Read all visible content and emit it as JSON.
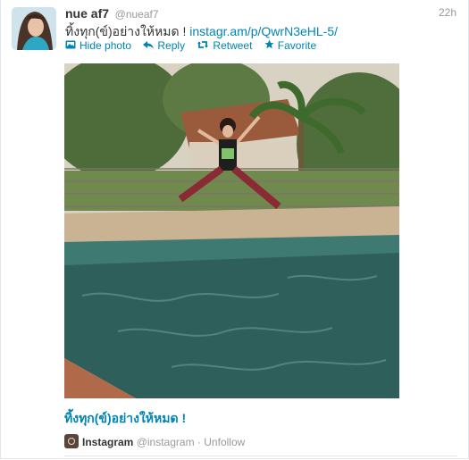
{
  "tweet": {
    "fullname": "nue af7",
    "screen_name": "@nueaf7",
    "time": "22h",
    "text": "ทิ้งทุก(ข์)อย่างให้หมด ! ",
    "link": "instagr.am/p/QwrN3eHL-5/"
  },
  "actions": {
    "hide_photo": "Hide photo",
    "reply": "Reply",
    "retweet": "Retweet",
    "favorite": "Favorite"
  },
  "card": {
    "caption": "ทิ้งทุก(ข์)อย่างให้หมด !",
    "source_name": "Instagram",
    "source_handle": "@instagram",
    "separator": "·",
    "unfollow": "Unfollow"
  },
  "icons": {
    "hide_photo": "photo-icon",
    "reply": "reply-icon",
    "retweet": "retweet-icon",
    "favorite": "star-icon",
    "source": "instagram-icon"
  },
  "colors": {
    "link": "#0084b4",
    "muted": "#999999",
    "text": "#333333"
  }
}
